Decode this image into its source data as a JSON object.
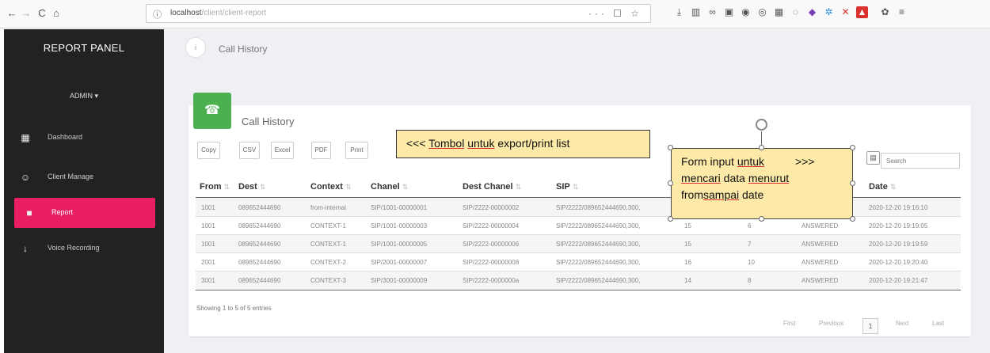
{
  "browser": {
    "back": "←",
    "forward": "→",
    "reload": "C",
    "home": "⌂",
    "url_lead": "ⓘ",
    "url_host": "localhost",
    "url_path": "/client/client-report",
    "url_actions": "··· ☐ ☆"
  },
  "sidebar": {
    "title": "REPORT PANEL",
    "user": "ADMIN ▾",
    "items": [
      {
        "label": "Dashboard",
        "icon": "▦"
      },
      {
        "label": "Client Manage",
        "icon": "☺"
      },
      {
        "label": "Report",
        "icon": "■"
      },
      {
        "label": "Voice Recording",
        "icon": "↓"
      }
    ],
    "active_color": "#e91e63"
  },
  "breadcrumb": {
    "icon": "i",
    "label": "Call History"
  },
  "card": {
    "icon": "☎",
    "icon_color": "#4caf50",
    "title": "Call History",
    "buttons": [
      "Copy",
      "CSV",
      "Excel",
      "PDF",
      "Print"
    ],
    "search_placeholder": "Search",
    "search_icon": "▤"
  },
  "table": {
    "columns": [
      "From",
      "Dest",
      "Context",
      "Chanel",
      "Dest Chanel",
      "SIP",
      "Date"
    ],
    "rows": [
      [
        "1001",
        "089652444690",
        "from-internal",
        "SIP/1001-00000001",
        "SIP/2222-00000002",
        "SIP/2222/089652444690,300,",
        "",
        "",
        "",
        "2020-12-20 19:16:10"
      ],
      [
        "1001",
        "089652444690",
        "CONTEXT-1",
        "SIP/1001-00000003",
        "SIP/2222-00000004",
        "SIP/2222/089652444690,300,",
        "15",
        "6",
        "ANSWERED",
        "2020-12-20 19:19:05"
      ],
      [
        "1001",
        "089652444690",
        "CONTEXT-1",
        "SIP/1001-00000005",
        "SIP/2222-00000006",
        "SIP/2222/089652444690,300,",
        "15",
        "7",
        "ANSWERED",
        "2020-12-20 19:19:59"
      ],
      [
        "2001",
        "089652444690",
        "CONTEXT-2",
        "SIP/2001-00000007",
        "SIP/2222-00000008",
        "SIP/2222/089652444690,300,",
        "16",
        "10",
        "ANSWERED",
        "2020-12-20 19:20:40"
      ],
      [
        "3001",
        "089652444690",
        "CONTEXT-3",
        "SIP/3001-00000009",
        "SIP/2222-0000000a",
        "SIP/2222/089652444690,300,",
        "14",
        "8",
        "ANSWERED",
        "2020-12-20 19:21:47"
      ]
    ],
    "info": "Showing 1 to 5 of 5 entries",
    "pagination": {
      "first": "First",
      "previous": "Previous",
      "current": "1",
      "next": "Next",
      "last": "Last"
    }
  },
  "notes": {
    "note1": {
      "text_a": "<<< ",
      "word_u1": "Tombol",
      "text_b": " ",
      "word_u2": "untuk",
      "text_c": " export/print list"
    },
    "note2": {
      "line1_a": "Form input ",
      "line1_u": "untuk",
      "line1_b": "          >>>",
      "line2_u1": "mencari",
      "line2_a": " data ",
      "line2_u2": "menurut",
      "line3_a": "from",
      "line3_u": "sampai",
      "line3_b": " date"
    }
  }
}
